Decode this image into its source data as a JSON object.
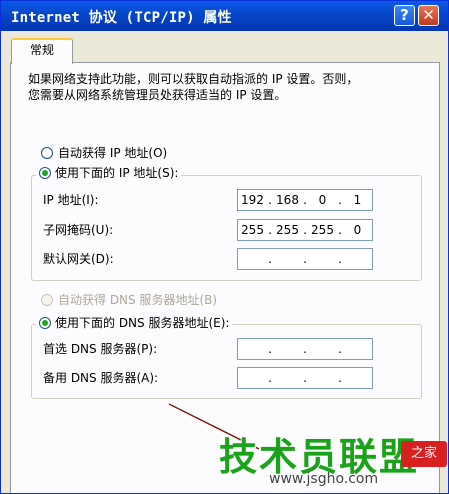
{
  "window": {
    "title": "Internet 协议 (TCP/IP) 属性",
    "help_label": "?",
    "close_label": "✕"
  },
  "tabs": [
    {
      "label": "常规"
    }
  ],
  "description": {
    "line1": "如果网络支持此功能，则可以获取自动指派的 IP 设置。否则，",
    "line2": "您需要从网络系统管理员处获得适当的 IP 设置。"
  },
  "ip": {
    "auto_label": "自动获得 IP 地址(O)",
    "manual_label": "使用下面的 IP 地址(S):",
    "selected": "manual",
    "address_label": "IP 地址(I):",
    "address": [
      "192",
      "168",
      "0",
      "1"
    ],
    "mask_label": "子网掩码(U):",
    "mask": [
      "255",
      "255",
      "255",
      "0"
    ],
    "gateway_label": "默认网关(D):",
    "gateway": [
      "",
      "",
      "",
      ""
    ]
  },
  "dns": {
    "auto_label": "自动获得 DNS 服务器地址(B)",
    "auto_enabled": false,
    "manual_label": "使用下面的 DNS 服务器地址(E):",
    "selected": "manual",
    "preferred_label": "首选 DNS 服务器(P):",
    "preferred": [
      "",
      "",
      "",
      ""
    ],
    "alternate_label": "备用 DNS 服务器(A):",
    "alternate": [
      "",
      "",
      "",
      ""
    ]
  },
  "watermark": {
    "logo_text": "技术员联盟",
    "url": "www.jsgho.com",
    "badge": "之家"
  },
  "colors": {
    "titlebar": "#0646c8",
    "accent_radio": "#21a121",
    "watermark_green": "#1aa31a"
  }
}
